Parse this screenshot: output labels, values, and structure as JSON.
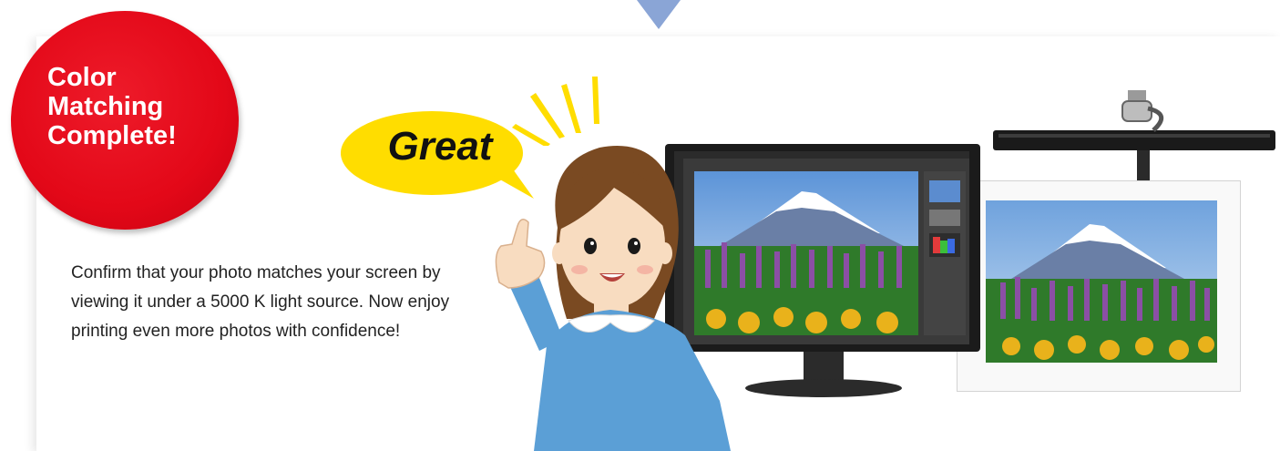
{
  "badge": {
    "text": "Color\nMatching\nComplete!",
    "color": "#e30818"
  },
  "bubble": {
    "text": "Great",
    "color": "#ffdd00"
  },
  "description": {
    "text": "Confirm that your photo matches your screen by viewing it under a 5000 K light source. Now enjoy printing even more photos with confidence!"
  },
  "colors": {
    "arrow": "#8aa5d6",
    "shirt": "#5b9fd6",
    "hair": "#7a4a22",
    "skin": "#f8dcc0"
  },
  "icons": {
    "arrow": "down-arrow-icon",
    "character": "woman-thumbs-up-illustration",
    "monitor": "monitor-photo",
    "lamp": "desk-lamp",
    "print": "printed-photo"
  }
}
